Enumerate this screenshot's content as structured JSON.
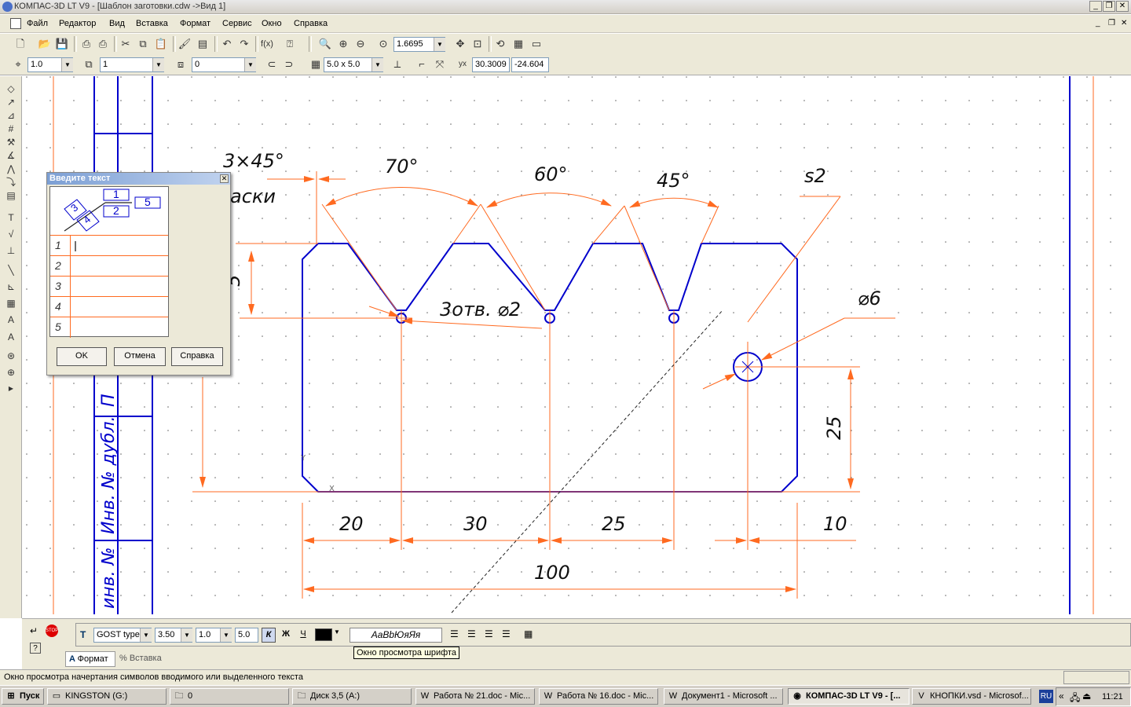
{
  "window": {
    "title": "КОМПАС-3D LT V9 - [Шаблон заготовки.cdw ->Вид 1]"
  },
  "menu": [
    "Файл",
    "Редактор",
    "Вид",
    "Вставка",
    "Формат",
    "Сервис",
    "Окно",
    "Справка"
  ],
  "toolbar": {
    "zoom_value": "1.6695",
    "style_value": "1.0",
    "layer_value": "1",
    "angle_value": "0",
    "grid_value": "5.0 x 5.0",
    "coord_x": "30.3009",
    "coord_y": "-24.604"
  },
  "dialog": {
    "title": "Введите текст",
    "scheme_labels": [
      "1",
      "2",
      "3",
      "4",
      "5"
    ],
    "rows": [
      {
        "n": "1",
        "text": "|"
      },
      {
        "n": "2",
        "text": ""
      },
      {
        "n": "3",
        "text": ""
      },
      {
        "n": "4",
        "text": ""
      },
      {
        "n": "5",
        "text": ""
      }
    ],
    "ok": "OK",
    "cancel": "Отмена",
    "help": "Справка"
  },
  "drawing": {
    "chamfer": "3×45°",
    "chamfer_note": "аски",
    "angle_1": "70°",
    "angle_2": "60°",
    "angle_3": "45°",
    "roughness": "s2",
    "holes": "3отв. ⌀2",
    "hole_dia": "⌀6",
    "dim_20": "20",
    "dim_30": "30",
    "dim_25_h": "25",
    "dim_10": "10",
    "dim_100": "100",
    "dim_25_v": "25",
    "dim_5": "5",
    "frame_text_1": "Инв. № дубл.",
    "frame_text_2": "инв. №",
    "frame_text_3": "П"
  },
  "propbar": {
    "font": "GOST type",
    "size": "3.50",
    "ratio": "1.0",
    "spacing": "5.0",
    "bold": "К",
    "italic": "Ж",
    "underline": "Ч",
    "preview": "АаВbЮяЯя",
    "tooltip": "Окно просмотра шрифта",
    "tab_format": "Формат",
    "tab_insert": "Вставка"
  },
  "status": "Окно просмотра начертания символов вводимого или выделенного текста",
  "taskbar": {
    "start": "Пуск",
    "tasks": [
      "KINGSTON (G:)",
      "0",
      "Диск 3,5 (A:)",
      "Работа № 21.doc - Mic...",
      "Работа № 16.doc - Mic...",
      "Документ1 - Microsoft ...",
      "КОМПАС-3D LT V9 - [...",
      "КНОПКИ.vsd - Microsof..."
    ],
    "lang": "RU",
    "clock": "11:21"
  },
  "colors": {
    "line": "#0000cc",
    "dimension": "#ff6a20",
    "chrome": "#ece9d8"
  }
}
